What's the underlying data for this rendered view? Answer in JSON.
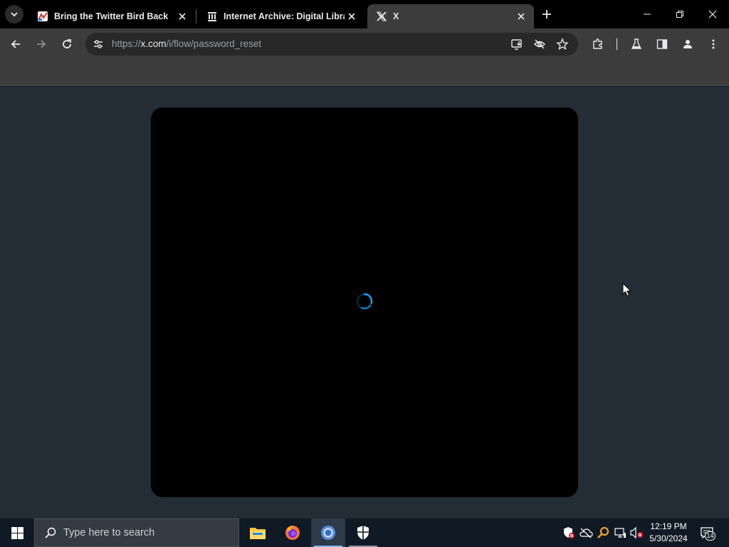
{
  "browser": {
    "tabs": [
      {
        "title": "Bring the Twitter Bird Back",
        "favicon": "twitter-bird-extension-icon",
        "active": false
      },
      {
        "title": "Internet Archive: Digital Library",
        "favicon": "internet-archive-icon",
        "active": false
      },
      {
        "title": "X",
        "favicon": "x-logo-icon",
        "active": true
      }
    ],
    "address_bar": {
      "scheme": "https://",
      "host": "x.com",
      "path": "/i/flow/password_reset"
    }
  },
  "page": {
    "modal_state": "loading"
  },
  "taskbar": {
    "search_placeholder": "Type here to search",
    "apps": [
      "file-explorer-icon",
      "firefox-icon",
      "chrome-icon",
      "windows-security-icon"
    ],
    "active_app": "chrome-icon",
    "clock_time": "12:19 PM",
    "clock_date": "5/30/2024",
    "notification_count": "14"
  },
  "colors": {
    "page_background": "#242d35",
    "modal_background": "#000000",
    "spinner": "#1d9bf0",
    "taskbar": "#101a24"
  }
}
